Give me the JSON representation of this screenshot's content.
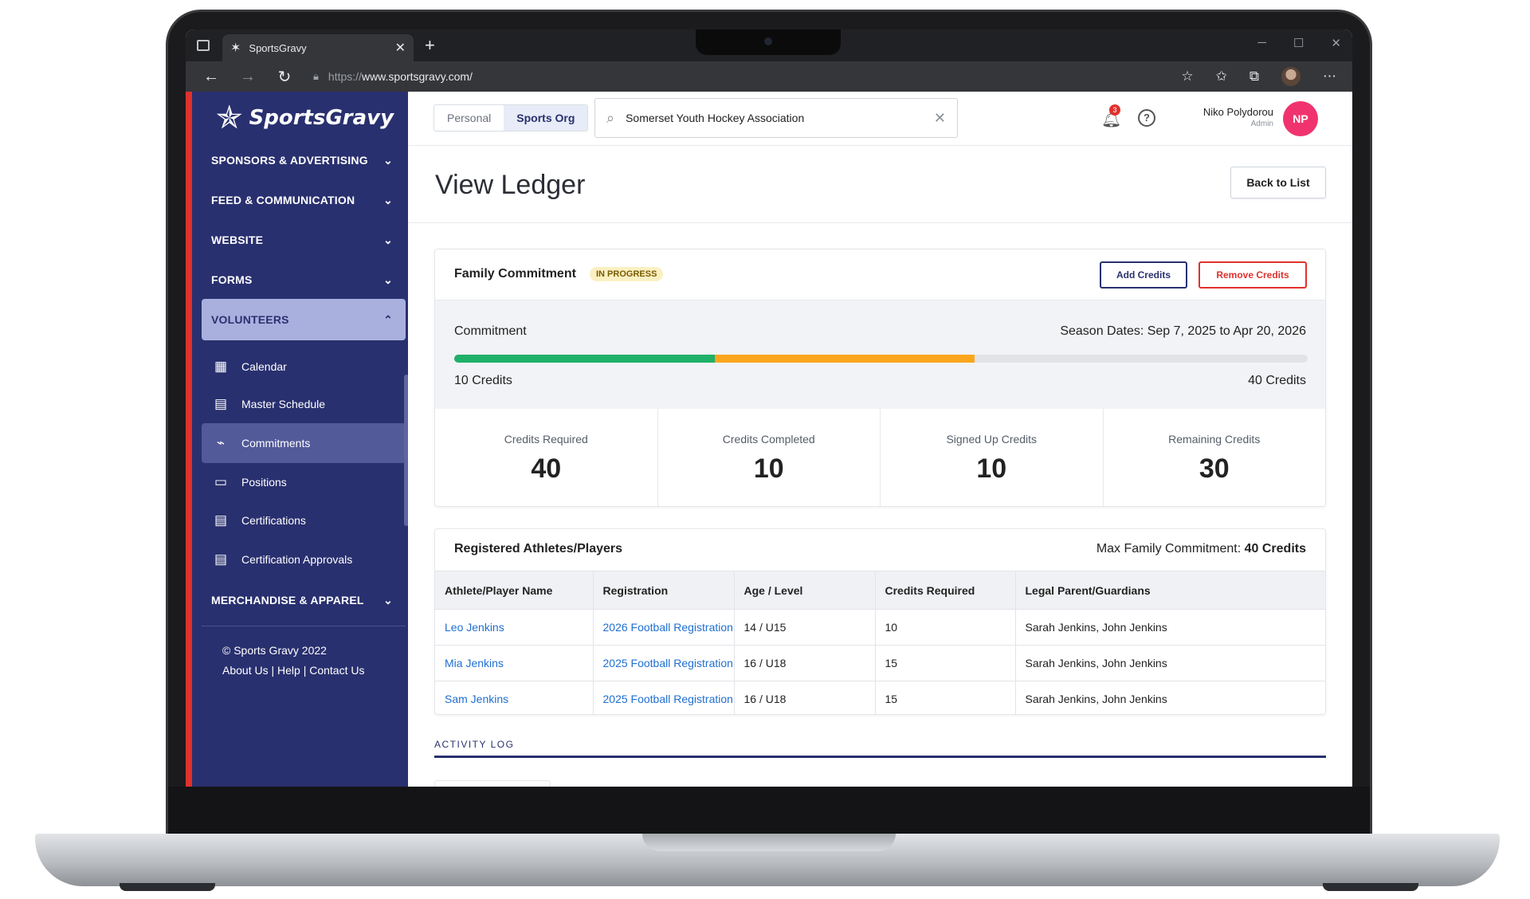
{
  "browser": {
    "tab_title": "SportsGravy",
    "url_protocol": "https://",
    "url_host": "www.sportsgravy.com/"
  },
  "sidebar": {
    "logo_text": "SportsGravy",
    "sections": [
      {
        "label": "SPONSORS & ADVERTISING"
      },
      {
        "label": "FEED & COMMUNICATION"
      },
      {
        "label": "WEBSITE"
      },
      {
        "label": "FORMS"
      },
      {
        "label": "VOLUNTEERS"
      },
      {
        "label": "MERCHANDISE & APPAREL"
      }
    ],
    "items": [
      {
        "label": "Calendar",
        "icon": "calendar-icon"
      },
      {
        "label": "Master Schedule",
        "icon": "document-icon"
      },
      {
        "label": "Commitments",
        "icon": "chart-icon"
      },
      {
        "label": "Positions",
        "icon": "briefcase-icon"
      },
      {
        "label": "Certifications",
        "icon": "document-icon"
      },
      {
        "label": "Certification Approvals",
        "icon": "document-icon"
      }
    ],
    "footer": {
      "copyright": "© Sports Gravy 2022",
      "about": "About Us",
      "help": "Help",
      "contact": "Contact Us",
      "sep": "|"
    }
  },
  "header": {
    "toggle": [
      "Personal",
      "Sports Org"
    ],
    "search_value": "Somerset Youth Hockey Association",
    "notifications_count": "3",
    "help_glyph": "?",
    "user_name": "Niko Polydorou",
    "user_role": "Admin",
    "avatar_initials": "NP"
  },
  "page": {
    "title": "View Ledger",
    "back_button": "Back to List"
  },
  "commitment": {
    "title": "Family Commitment",
    "status": "IN PROGRESS",
    "add_button": "Add Credits",
    "remove_button": "Remove Credits",
    "label": "Commitment",
    "season_dates": "Season Dates: Sep 7, 2025 to Apr 20, 2026",
    "progress": {
      "completed_fraction": 0.305,
      "signed_up_fraction": 0.305
    },
    "min_label": "10 Credits",
    "max_label": "40 Credits",
    "colors": {
      "completed": "#1fb06a",
      "signed_up": "#fba51d",
      "remaining": "#e2e3e6"
    },
    "stats": [
      {
        "label": "Credits Required",
        "value": "40"
      },
      {
        "label": "Credits Completed",
        "value": "10"
      },
      {
        "label": "Signed Up Credits",
        "value": "10"
      },
      {
        "label": "Remaining Credits",
        "value": "30"
      }
    ]
  },
  "athletes": {
    "title": "Registered Athletes/Players",
    "max_label": "Max Family Commitment:",
    "max_value": "40 Credits",
    "columns": [
      "Athlete/Player Name",
      "Registration",
      "Age / Level",
      "Credits Required",
      "Legal Parent/Guardians"
    ],
    "rows": [
      [
        "Leo Jenkins",
        "2026 Football Registration",
        "14 / U15",
        "10",
        "Sarah Jenkins, John Jenkins"
      ],
      [
        "Mia Jenkins",
        "2025 Football Registration",
        "16 / U18",
        "15",
        "Sarah Jenkins, John Jenkins"
      ],
      [
        "Sam Jenkins",
        "2025 Football Registration",
        "16 / U18",
        "15",
        "Sarah Jenkins, John Jenkins"
      ]
    ]
  },
  "activity_log": {
    "label": "ACTIVITY LOG"
  }
}
